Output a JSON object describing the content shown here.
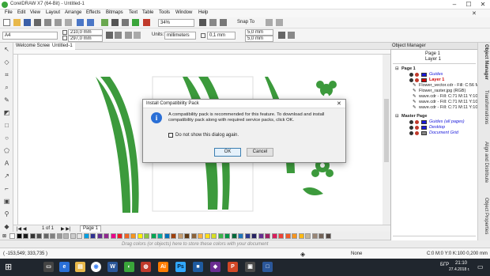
{
  "app": {
    "title": "CorelDRAW X7 (64-Bit) - Untitled-1",
    "brand_color": "#3aa53a"
  },
  "window_controls": {
    "minimize": "–",
    "maximize": "☐",
    "close": "✕"
  },
  "menu": [
    "File",
    "Edit",
    "View",
    "Layout",
    "Arrange",
    "Effects",
    "Bitmaps",
    "Text",
    "Table",
    "Tools",
    "Window",
    "Help"
  ],
  "toolbar": {
    "zoom": "34%",
    "snap_to": "Snap To"
  },
  "propbar": {
    "paper": "A4",
    "width": "210,0 mm",
    "height": "297,0 mm",
    "units_label": "Units:",
    "units": "millimeters",
    "nudge": "0,1 mm",
    "dup_x": "5,0 mm",
    "dup_y": "5,0 mm"
  },
  "doc_tabs": [
    "Welcome Screen",
    "Untitled-1"
  ],
  "page_nav": {
    "count": "1 of 1",
    "page_tab": "Page 1"
  },
  "palette_hint": "Drag colors (or objects) here to store these colors with your document",
  "status": {
    "coords": "( -153,549; 333,735 )",
    "fill": "None",
    "outline": "C:0 M:0 Y:0 K:100  0,200 mm"
  },
  "object_manager": {
    "title": "Object Manager",
    "page": "Page 1",
    "layer": "Layer 1",
    "items": [
      {
        "label": "Page 1",
        "kind": "page",
        "color": "#ffffff"
      },
      {
        "label": "Guides",
        "kind": "layer-italic",
        "color": "#1a1adb"
      },
      {
        "label": "Layer 1",
        "kind": "layer-active",
        "color": "#d00000"
      },
      {
        "label": "Flower_vector.cdr - Fill: C:56 M:",
        "kind": "object",
        "color": ""
      },
      {
        "label": "Flower_raster.jpg (RGB)",
        "kind": "object",
        "color": ""
      },
      {
        "label": "wave.cdr - Fill: C:71 M:11 Y:100",
        "kind": "object",
        "color": ""
      },
      {
        "label": "wave.cdr - Fill: C:71 M:11 Y:100",
        "kind": "object",
        "color": ""
      },
      {
        "label": "wave.cdr - Fill: C:71 M:11 Y:100",
        "kind": "object",
        "color": ""
      },
      {
        "label": "Master Page",
        "kind": "page",
        "color": "#ffffff"
      },
      {
        "label": "Guides (all pages)",
        "kind": "layer-italic",
        "color": "#1a1adb"
      },
      {
        "label": "Desktop",
        "kind": "layer-italic",
        "color": "#1a1adb"
      },
      {
        "label": "Document Grid",
        "kind": "layer-italic",
        "color": "#888888"
      }
    ]
  },
  "side_tabs": [
    "Object Manager",
    "Transformations",
    "Align and Distribute",
    "Object Properties"
  ],
  "dialog": {
    "title": "Install Compatibility Pack",
    "message": "A compatibility pack is recommended for this feature. To download and install compatibility pack along with required service packs, click OK.",
    "checkbox": "Do not show this dialog again.",
    "ok": "OK",
    "cancel": "Cancel"
  },
  "taskbar": {
    "time": "21:10",
    "date": "27.4.2018 г.",
    "lang": "БГР"
  },
  "art": {
    "green": "#3c9a3c"
  },
  "swatches": [
    "#ffffff",
    "#000000",
    "#1b1b1b",
    "#333333",
    "#4d4d4d",
    "#666666",
    "#808080",
    "#999999",
    "#b3b3b3",
    "#cccccc",
    "#e6e6e6",
    "#00a0e3",
    "#2e3192",
    "#662d91",
    "#92278f",
    "#ec008c",
    "#ed1c24",
    "#f26522",
    "#f7941d",
    "#fff200",
    "#8dc63f",
    "#00a651",
    "#00a99d",
    "#0072bc",
    "#a0410d",
    "#c69c6d",
    "#603913",
    "#8c6239",
    "#fbb040",
    "#ffde17",
    "#d7df23",
    "#39b54a",
    "#009444",
    "#006838",
    "#1c75bc",
    "#2b3990",
    "#262262",
    "#652d90",
    "#9e1f63",
    "#da1c5c",
    "#ef4136",
    "#f15a29",
    "#f7941d",
    "#fdb913",
    "#c2b59b",
    "#998675",
    "#736357",
    "#534741"
  ]
}
